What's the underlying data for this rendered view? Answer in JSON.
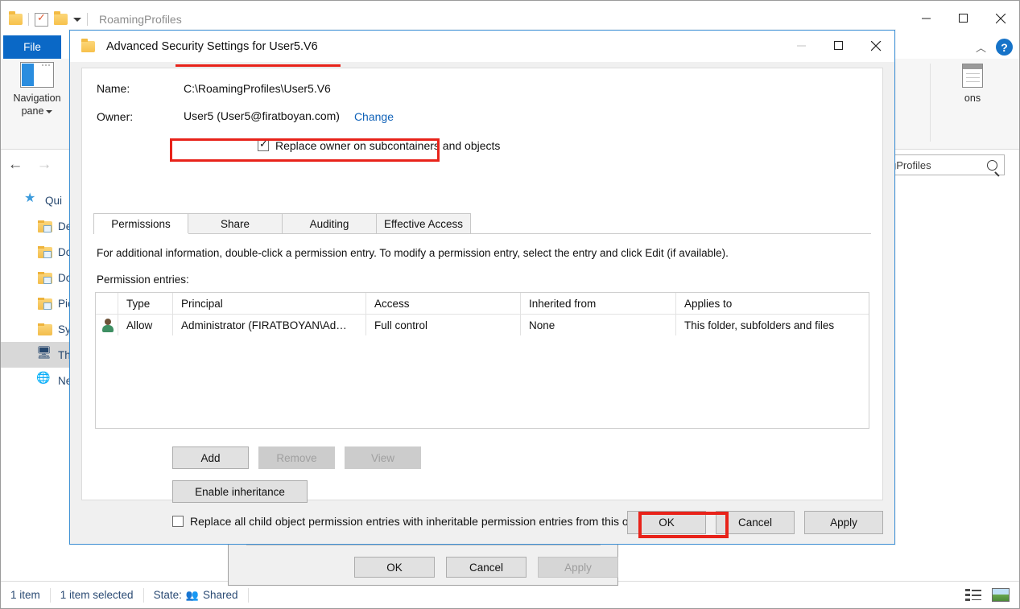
{
  "explorer": {
    "title": "RoamingProfiles",
    "quick_access_icons": [
      "folder-icon",
      "properties-icon",
      "folder-icon",
      "dropdown-caret-icon"
    ],
    "window_controls": [
      "minimize",
      "maximize",
      "close"
    ],
    "ribbon": {
      "file_tab": "File",
      "navigation_pane_label_line1": "Navigation",
      "navigation_pane_label_line2": "pane",
      "options_label": "ons",
      "collapse_icon": "chevron-up-icon",
      "help_icon": "?"
    },
    "address_bar": {
      "back": "←",
      "forward": "→",
      "search_value": "gProfiles"
    },
    "nav_tree": [
      {
        "label": "Qui",
        "icon": "star-icon",
        "indent": false,
        "selected": false
      },
      {
        "label": "De",
        "icon": "folder-desktop-icon",
        "indent": true,
        "selected": false
      },
      {
        "label": "Do",
        "icon": "folder-downloads-icon",
        "indent": true,
        "selected": false
      },
      {
        "label": "Do",
        "icon": "folder-documents-icon",
        "indent": true,
        "selected": false
      },
      {
        "label": "Pic",
        "icon": "folder-pictures-icon",
        "indent": true,
        "selected": false
      },
      {
        "label": "Sy",
        "icon": "folder-icon",
        "indent": true,
        "selected": false
      },
      {
        "label": "This",
        "icon": "this-pc-icon",
        "indent": true,
        "selected": true
      },
      {
        "label": "Net",
        "icon": "network-icon",
        "indent": true,
        "selected": false
      }
    ],
    "status_bar": {
      "item_count": "1 item",
      "selected_count": "1 item selected",
      "state_label": "State:",
      "state_value": "Shared",
      "view_details_icon": "details-view-icon",
      "view_large_icon": "large-icons-view-icon"
    }
  },
  "properties_dialog": {
    "ok": "OK",
    "cancel": "Cancel",
    "apply": "Apply",
    "apply_disabled": true
  },
  "advanced_dialog": {
    "title": "Advanced Security Settings for User5.V6",
    "name_label": "Name:",
    "name_value": "C:\\RoamingProfiles\\User5.V6",
    "owner_label": "Owner:",
    "owner_value": "User5 (User5@firatboyan.com)",
    "change_link": "Change",
    "replace_owner_label": "Replace owner on subcontainers and objects",
    "replace_owner_checked": true,
    "tabs": [
      {
        "label": "Permissions",
        "active": true
      },
      {
        "label": "Share",
        "active": false
      },
      {
        "label": "Auditing",
        "active": false
      },
      {
        "label": "Effective Access",
        "active": false
      }
    ],
    "info_text": "For additional information, double-click a permission entry. To modify a permission entry, select the entry and click Edit (if available).",
    "entries_label": "Permission entries:",
    "table": {
      "columns": [
        "",
        "Type",
        "Principal",
        "Access",
        "Inherited from",
        "Applies to"
      ],
      "rows": [
        {
          "icon": "user-icon",
          "type": "Allow",
          "principal": "Administrator (FIRATBOYAN\\Ad…",
          "access": "Full control",
          "inherited_from": "None",
          "applies_to": "This folder, subfolders and files"
        }
      ]
    },
    "buttons": {
      "add": "Add",
      "remove": "Remove",
      "remove_disabled": true,
      "view": "View",
      "view_disabled": true,
      "enable_inheritance": "Enable inheritance"
    },
    "replace_child_label": "Replace all child object permission entries with inheritable permission entries from this object",
    "replace_child_checked": false,
    "footer": {
      "ok": "OK",
      "cancel": "Cancel",
      "apply": "Apply"
    },
    "window_controls": [
      "minimize",
      "maximize",
      "close"
    ]
  },
  "annotations": {
    "highlight_color": "#e8231a",
    "boxes": [
      "replace-owner-checkbox",
      "ok-button"
    ],
    "underlines": [
      "owner-value"
    ]
  }
}
